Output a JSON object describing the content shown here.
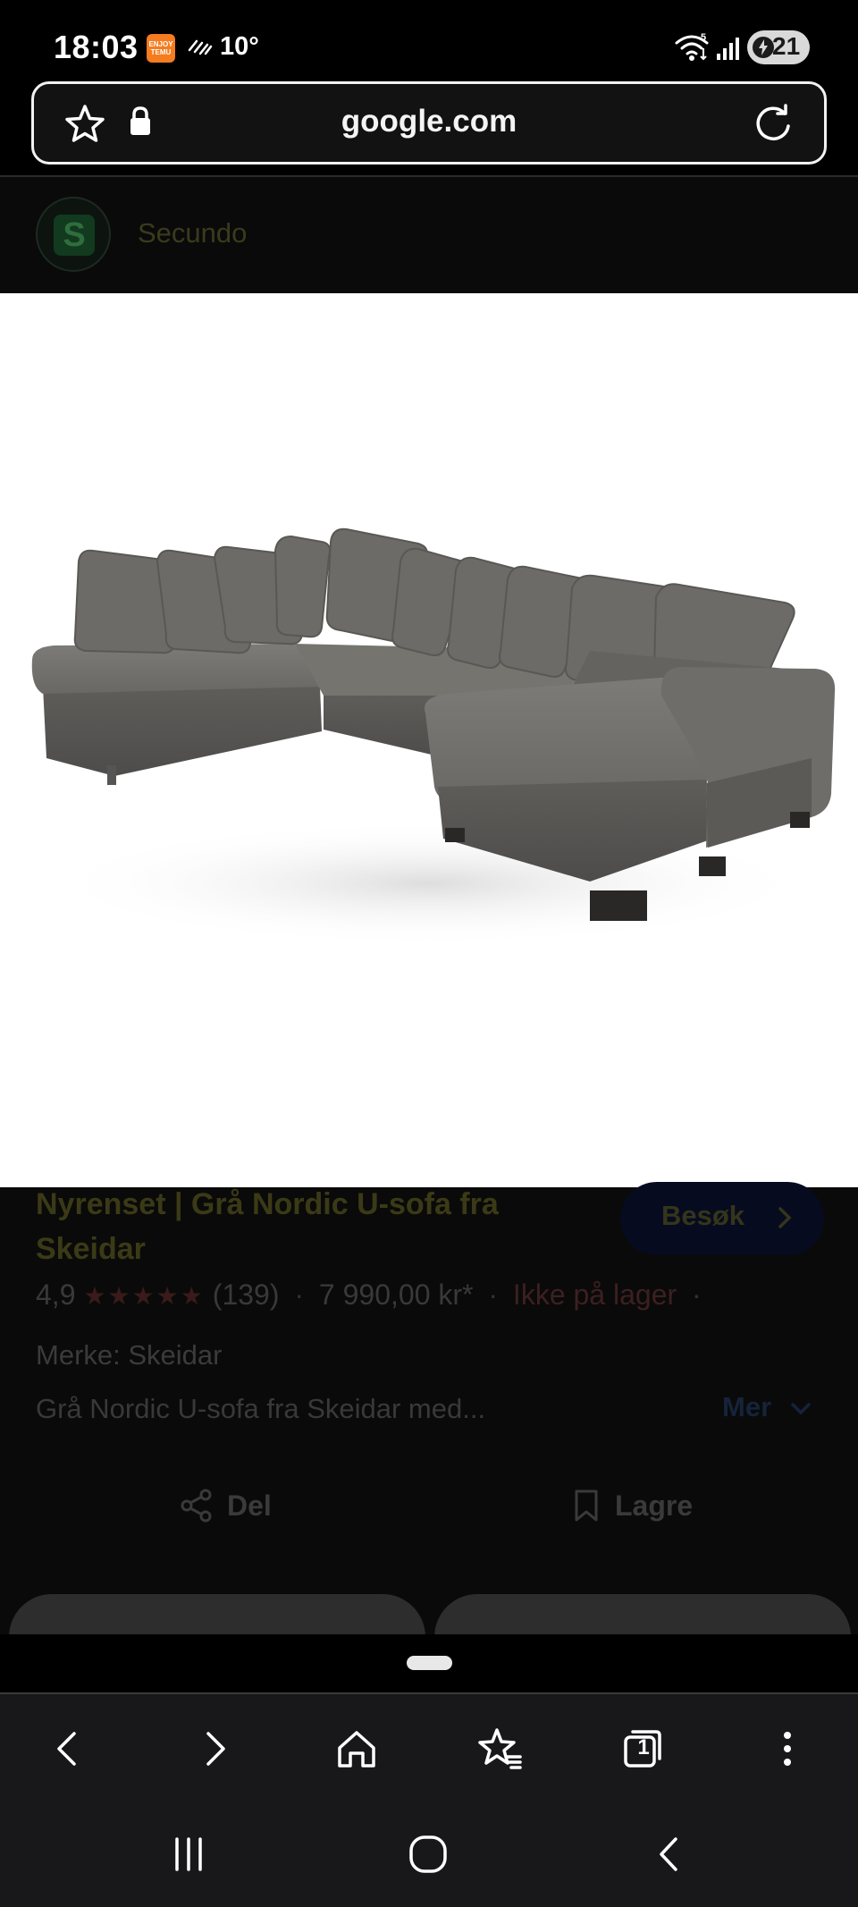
{
  "status_bar": {
    "time": "18:03",
    "temu_badge": "ENJOY TEMU",
    "temperature": "10°",
    "battery_level": "21",
    "icons": [
      "temu-app-icon",
      "haze-icon",
      "wifi-icon",
      "signal-icon",
      "battery-icon"
    ]
  },
  "url_bar": {
    "domain": "google.com",
    "icons": [
      "star-icon",
      "lock-icon",
      "reload-icon"
    ]
  },
  "site": {
    "avatar_letter": "S",
    "name": "Secundo"
  },
  "result": {
    "title": "Nyrenset | Grå Nordic U-sofa fra Skeidar",
    "visit_label": "Besøk",
    "rating": "4,9",
    "stars": "★★★★★",
    "reviews": "(139)",
    "price": "7 990,00 kr*",
    "stock": "Ikke på lager",
    "brand": "Merke: Skeidar",
    "description": "Grå Nordic U-sofa fra Skeidar med...",
    "more_label": "Mer",
    "share_label": "Del",
    "save_label": "Lagre"
  },
  "toolbar": {
    "tab_count": "1",
    "items": [
      "back-icon",
      "forward-icon",
      "home-icon",
      "bookmarks-icon",
      "tabs-icon",
      "more-options-icon"
    ]
  },
  "system_nav": {
    "items": [
      "recent-apps-icon",
      "home-button-icon",
      "back-nav-icon"
    ]
  },
  "colors": {
    "background": "#000000",
    "toolbar": "#18181b",
    "url_border": "#f2f2f2",
    "sofa_fabric": "#6b6966"
  }
}
